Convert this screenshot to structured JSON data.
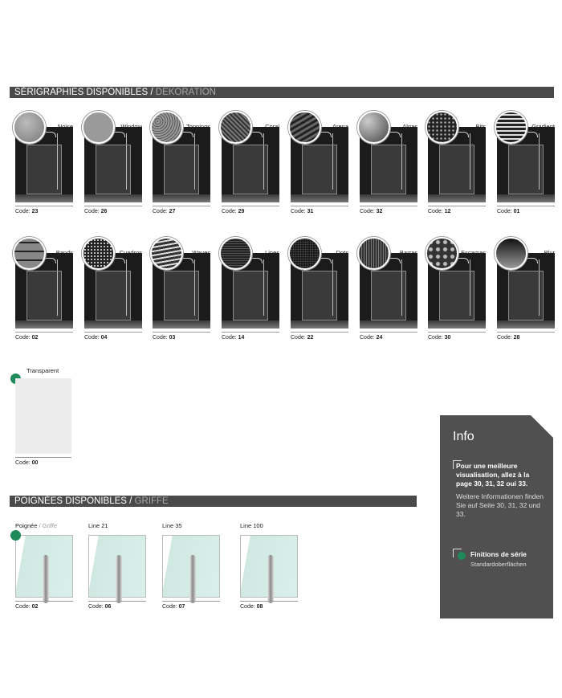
{
  "serigraphies": {
    "title": "SÉRIGRAPHIES DISPONIBLES",
    "separator": " / ",
    "subtitle": "DEKORATION",
    "code_prefix": "Code: ",
    "row1": [
      {
        "name": "Noise",
        "code": "23",
        "pattern": "noise"
      },
      {
        "name": "Window",
        "code": "26",
        "pattern": "window"
      },
      {
        "name": "Toppings",
        "code": "27",
        "pattern": "toppings"
      },
      {
        "name": "Coral",
        "code": "29",
        "pattern": "coral"
      },
      {
        "name": "Arena",
        "code": "31",
        "pattern": "arena"
      },
      {
        "name": "Algas",
        "code": "32",
        "pattern": "algas"
      },
      {
        "name": "Bits",
        "code": "12",
        "pattern": "bits"
      },
      {
        "name": "Gradient",
        "code": "01",
        "pattern": "gradient"
      }
    ],
    "row2": [
      {
        "name": "Bands",
        "code": "02",
        "pattern": "bands"
      },
      {
        "name": "Cuadros",
        "code": "04",
        "pattern": "cuadros"
      },
      {
        "name": "Waves",
        "code": "03",
        "pattern": "waves"
      },
      {
        "name": "Lines",
        "code": "14",
        "pattern": "lines"
      },
      {
        "name": "Dots",
        "code": "22",
        "pattern": "dots"
      },
      {
        "name": "Barras",
        "code": "24",
        "pattern": "barras"
      },
      {
        "name": "Escamas",
        "code": "30",
        "pattern": "escamas"
      },
      {
        "name": "Blur",
        "code": "28",
        "pattern": "blur"
      }
    ],
    "transparent": {
      "name": "Transparent",
      "code": "00"
    }
  },
  "poignees": {
    "title": "POIGNÉES DISPONIBLES",
    "separator": " / ",
    "subtitle": "GRIFFE",
    "items": [
      {
        "label": "Poignée",
        "label_sep": " / ",
        "label_sub": "Griffe",
        "code": "02"
      },
      {
        "label": "Line 21",
        "label_sep": "",
        "label_sub": "",
        "code": "06"
      },
      {
        "label": "Line 35",
        "label_sep": "",
        "label_sub": "",
        "code": "07"
      },
      {
        "label": "Line 100",
        "label_sep": "",
        "label_sub": "",
        "code": "08"
      }
    ]
  },
  "info": {
    "title": "Info",
    "text_fr": "Pour une meilleure visualisation, allez à la page 30, 31, 32 oui 33.",
    "text_de": "Weitere Informationen finden Sie auf Seite 30, 31, 32 und 33.",
    "legend_fr": "Finitions de série",
    "legend_de": "Standardoberflächen"
  },
  "colors": {
    "accent_green": "#1e8a5a",
    "bar_gray": "#4a4a4a",
    "info_bg": "#505050"
  }
}
